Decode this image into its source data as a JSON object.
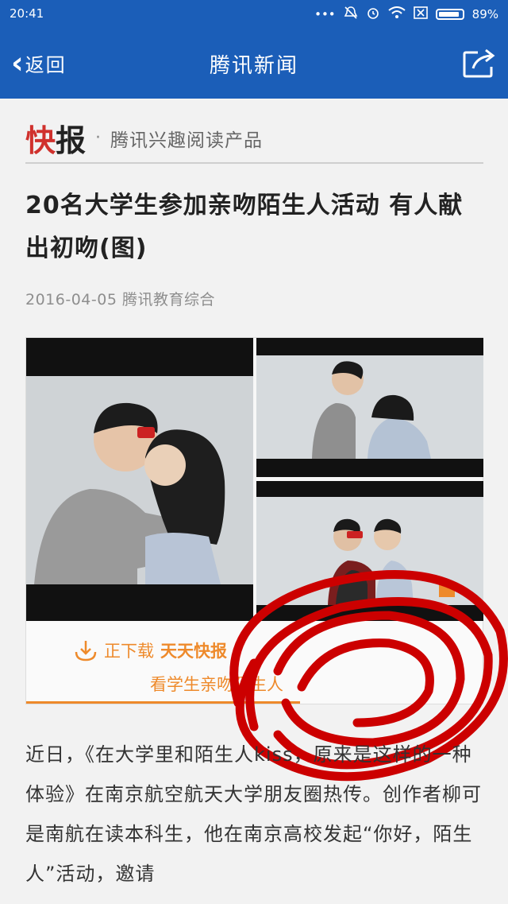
{
  "status_bar": {
    "time": "20:41",
    "battery": "89%"
  },
  "nav": {
    "back_label": "返回",
    "title": "腾讯新闻"
  },
  "brand": {
    "logo_part1": "快",
    "logo_part2": "报",
    "separator": "·",
    "tagline": "腾讯兴趣阅读产品"
  },
  "article": {
    "title": "20名大学生参加亲吻陌生人活动 有人献出初吻(图)",
    "date": "2016-04-05",
    "source": "腾讯教育综合"
  },
  "download_banner": {
    "prefix": "正下载",
    "app_name": "天天快报",
    "line2": "看学生亲吻陌生人"
  },
  "body_paragraph": "近日，《在大学里和陌生人kiss，原来是这样的一种体验》在南京航空航天大学朋友圈热传。创作者柳可是南航在读本科生，他在南京高校发起“你好，陌生人”活动，邀请"
}
